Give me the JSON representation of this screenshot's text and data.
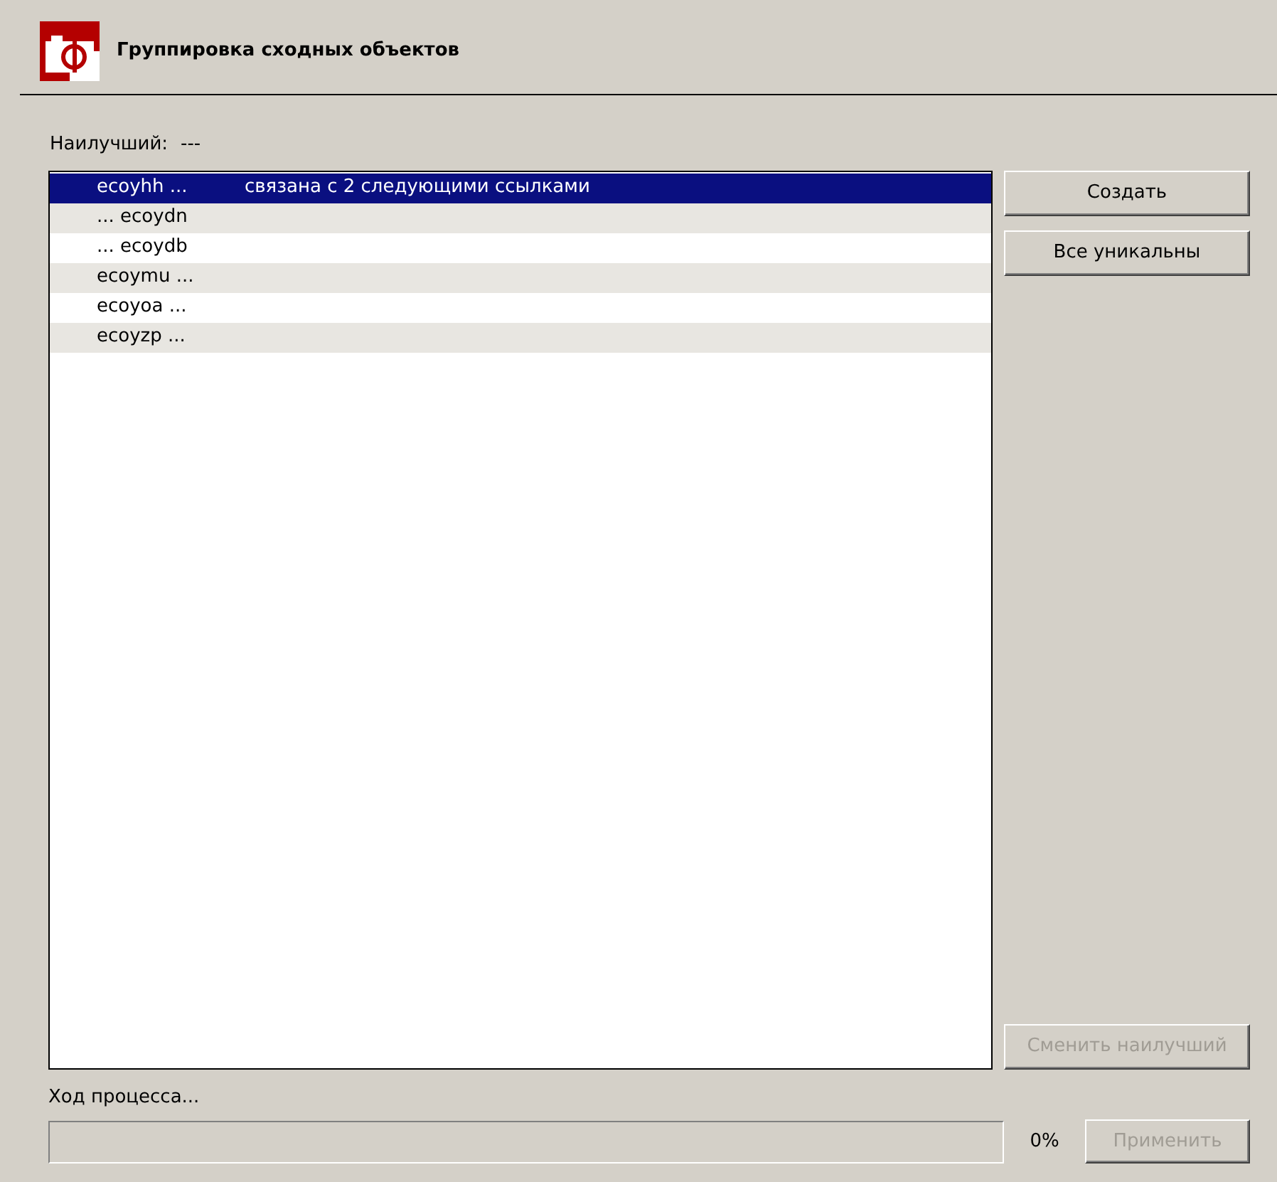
{
  "header": {
    "title": "Группировка сходных объектов"
  },
  "best": {
    "label": "Наилучший:",
    "value": "---"
  },
  "list": {
    "rows": [
      {
        "name": "ecoyhh ...",
        "note": "связана с 2 следующими ссылками",
        "selected": true
      },
      {
        "name": "... ecoydn",
        "selected": false
      },
      {
        "name": "... ecoydb",
        "selected": false
      },
      {
        "name": "ecoymu ...",
        "selected": false
      },
      {
        "name": "ecoyoa ...",
        "selected": false
      },
      {
        "name": "ecoyzp ...",
        "selected": false
      }
    ]
  },
  "side_buttons": [
    {
      "label": "Создать",
      "disabled": false
    },
    {
      "label": "Все уникальны",
      "disabled": false
    }
  ],
  "change_best_button": {
    "label": "Сменить наилучший",
    "disabled": true
  },
  "progress": {
    "label": "Ход процесса...",
    "level": 0,
    "percent": "0%"
  },
  "apply_button": {
    "label": "Применить",
    "disabled": true
  }
}
